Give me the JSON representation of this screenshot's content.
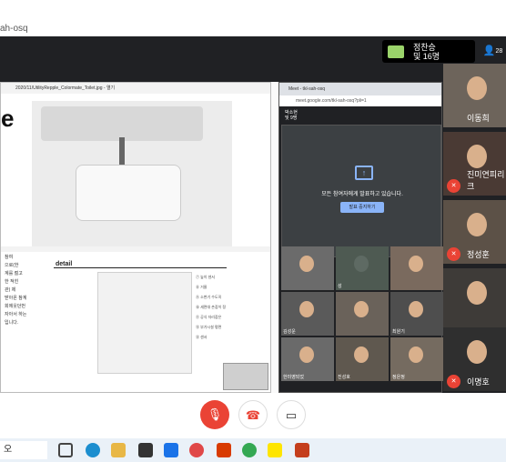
{
  "browser": {
    "url_fragment": "ah-osq"
  },
  "meet": {
    "host": {
      "line1": "정찬승",
      "line2": "및 16명"
    },
    "participant_count": "28"
  },
  "shared_window": {
    "title": "2020/11/UtilityRepple_Colormate_Toilet.jpg - 열기",
    "big_letter": "e",
    "detail_label": "detail",
    "left_notes": [
      "참여",
      "으로(한",
      "계를 젊고",
      "",
      "한 적힌",
      "관) 제",
      "받아온 참계",
      "회에웃던번",
      "",
      "자아서 하는",
      "입니다."
    ],
    "right_notes": [
      "⑦ 높이 센서",
      "⑧ 거울",
      "⑨ 소변기 수도꼭",
      "⑩ 세면대 손잡이 정",
      "⑪ 공식 자리잡은",
      "⑫ 부가시설 평면",
      "⑬ 센서"
    ]
  },
  "inner_meet": {
    "tab": "Meet - tkl-sah-osq",
    "url": "meet.google.com/tkl-sah-osq?pli=1",
    "badge": {
      "line1": "박소현",
      "line2": "및 9명"
    },
    "presenting_text": "모든 참여자에게 발표하고 있습니다.",
    "stop_button": "발표 중지하기",
    "side_letters": "표\n중\n입\n니\n다",
    "grid": [
      "",
      "성",
      "",
      "김성운",
      "",
      "최원기",
      "한미영되었",
      "진성호",
      "정은정",
      "이영호",
      "",
      "김상효"
    ]
  },
  "right_tiles": [
    {
      "name": "이동희",
      "muted": false
    },
    {
      "name": "진미연피리크",
      "muted": true
    },
    {
      "name": "정성훈",
      "muted": true
    },
    {
      "name": "",
      "muted": false
    },
    {
      "name": "이명호",
      "muted": true
    }
  ],
  "controls": {
    "mic": "mic-off",
    "hangup": "hangup",
    "camera": "camera"
  },
  "taskbar": {
    "search": "오"
  }
}
